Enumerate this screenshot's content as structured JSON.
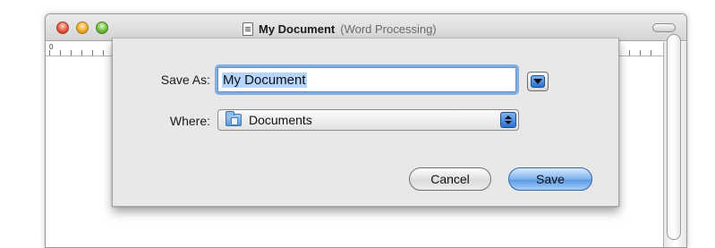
{
  "window": {
    "title": "My Document",
    "subtitle": "(Word Processing)",
    "ruler_zero": "0"
  },
  "sheet": {
    "save_as_label": "Save As:",
    "save_as_value": "My Document",
    "where_label": "Where:",
    "where_value": "Documents",
    "cancel_label": "Cancel",
    "save_label": "Save"
  },
  "colors": {
    "focus_ring": "#7eaee8",
    "default_button": "#5b9be6",
    "sheet_bg": "#e8e8e8"
  },
  "icons": {
    "close": "close-icon",
    "minimize": "minimize-icon",
    "zoom": "zoom-icon",
    "document": "document-icon",
    "folder": "folder-icon",
    "expand": "chevron-down-icon",
    "stepper": "updown-icon"
  }
}
